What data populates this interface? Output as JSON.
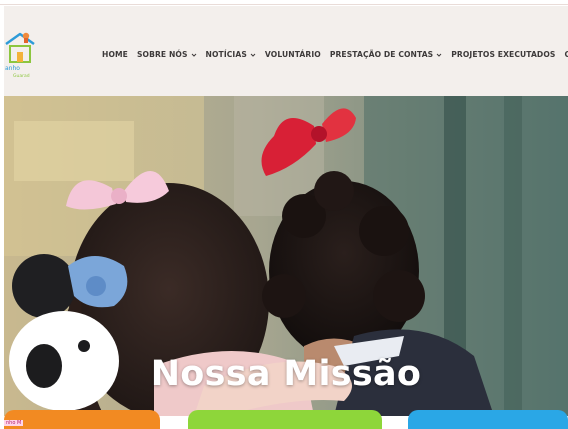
{
  "nav": {
    "items": [
      {
        "label": "HOME",
        "dropdown": false
      },
      {
        "label": "SOBRE NÓS",
        "dropdown": true
      },
      {
        "label": "NOTÍCIAS",
        "dropdown": true
      },
      {
        "label": "VOLUNTÁRIO",
        "dropdown": false
      },
      {
        "label": "PRESTAÇÃO DE CONTAS",
        "dropdown": true
      },
      {
        "label": "PROJETOS EXECUTADOS",
        "dropdown": false
      },
      {
        "label": "CO",
        "dropdown": false
      }
    ]
  },
  "hero": {
    "title": "Nossa Missão"
  },
  "bottom": {
    "tag": "nho M"
  },
  "colors": {
    "header_bg": "#f3efec",
    "nav_text": "#3d3a3a",
    "card_orange": "#f28a22",
    "card_green": "#8ed63a",
    "card_blue": "#2aa7e6"
  },
  "icons": {
    "logo": "house-logo-icon",
    "caret": "chevron-down-icon"
  }
}
